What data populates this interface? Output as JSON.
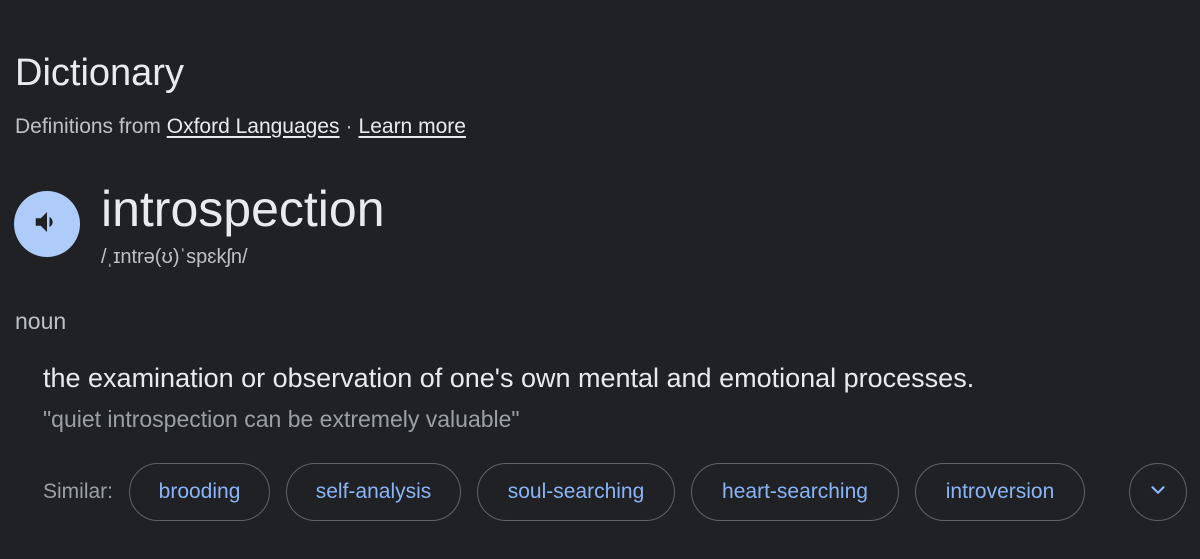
{
  "header": {
    "title": "Dictionary",
    "source_prefix": "Definitions from",
    "source_link": "Oxford Languages",
    "separator": "·",
    "learn_more": "Learn more"
  },
  "entry": {
    "word": "introspection",
    "phonetic": "/ˌɪntrə(ʊ)ˈspɛkʃn/",
    "speaker_icon": "volume-icon",
    "part_of_speech": "noun",
    "definition": "the examination or observation of one's own mental and emotional processes.",
    "example": "\"quiet introspection can be extremely valuable\""
  },
  "similar": {
    "label": "Similar:",
    "chips": [
      "brooding",
      "self-analysis",
      "soul-searching",
      "heart-searching",
      "introversion"
    ],
    "expand_icon": "chevron-down-icon"
  },
  "colors": {
    "background": "#202124",
    "text": "#e8eaed",
    "secondary_text": "#bdc1c6",
    "muted_text": "#9aa0a6",
    "link_chip": "#8ab4f8",
    "speaker_bg": "#aecbfa",
    "chip_border": "#5f6368"
  }
}
